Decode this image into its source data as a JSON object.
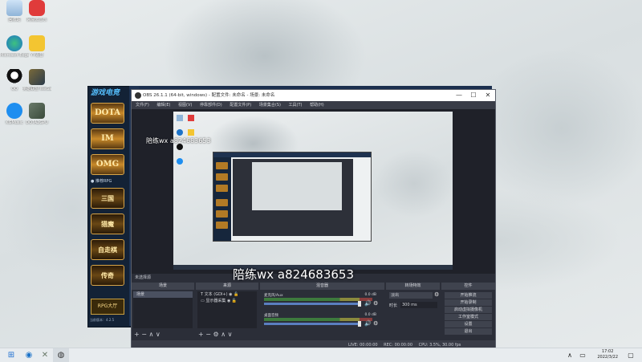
{
  "desktop": {
    "icons": [
      {
        "name": "回收站",
        "label": "回收站"
      },
      {
        "name": "网易云音乐",
        "label": "网易云音乐"
      },
      {
        "name": "Microsoft Edge",
        "label": "Microsoft Edge"
      },
      {
        "name": "YY语音",
        "label": "YY语音"
      },
      {
        "name": "QQ",
        "label": "QQ"
      },
      {
        "name": "英雄联盟",
        "label": "英雄联盟 WeGame版"
      },
      {
        "name": "酷狗",
        "label": "KGMusic"
      },
      {
        "name": "DOTA2",
        "label": "DOTA2GPU"
      }
    ]
  },
  "launcher": {
    "title": "游戏电竞",
    "games": [
      "DOTA",
      "IM",
      "OMG"
    ],
    "section_label": "● 推荐RPG",
    "rpg_tiles": [
      "三国",
      "猎魔",
      "自走棋",
      "传奇"
    ],
    "bottom_button": "RPG大厅",
    "version": "当前版本：4.2.5"
  },
  "obs": {
    "title": "OBS 26.1.1 (64-bit, windows) - 配置文件: 未命名 - 场景: 未命名",
    "window_controls": {
      "min": "—",
      "max": "☐",
      "close": "✕"
    },
    "menu": [
      "文件(F)",
      "编辑(E)",
      "视图(V)",
      "停靠部件(D)",
      "配置文件(P)",
      "场景集合(S)",
      "工具(T)",
      "帮助(H)"
    ],
    "preview_watermark": "陪练wx  a824683653",
    "nested_watermark": "陪练wx  a824683653",
    "preview_bar_label": "未选择源",
    "docks": {
      "scenes": {
        "title": "场景",
        "items": [
          "场景"
        ],
        "footer": "+ − ∧ ∨"
      },
      "sources": {
        "title": "来源",
        "items": [
          "文本 (GDI+)",
          "显示器采集"
        ],
        "footer": "+ − ⚙ ∧ ∨"
      },
      "mixer": {
        "title": "混音器",
        "channels": [
          {
            "name": "麦克风/Aux",
            "db": "0.0 dB"
          },
          {
            "name": "桌面音频",
            "db": "0.0 dB"
          }
        ]
      },
      "transitions": {
        "title": "转场特效",
        "type": "淡出",
        "duration_label": "时长",
        "duration": "300 ms"
      },
      "controls": {
        "title": "控件",
        "buttons": [
          "开始推流",
          "开始录制",
          "启动虚拟摄像机",
          "工作室模式",
          "设置",
          "退出"
        ]
      }
    },
    "status": {
      "live": "LIVE: 00:00:00",
      "rec": "REC: 00:00:00",
      "cpu": "CPU: 3.5%, 30.00 fps"
    }
  },
  "taskbar": {
    "time": "17:02",
    "date": "2022/3/22"
  },
  "colors": {
    "launcher_bg": "#132236",
    "obs_bg": "#2b2e38",
    "accent": "#5a7fc0"
  }
}
